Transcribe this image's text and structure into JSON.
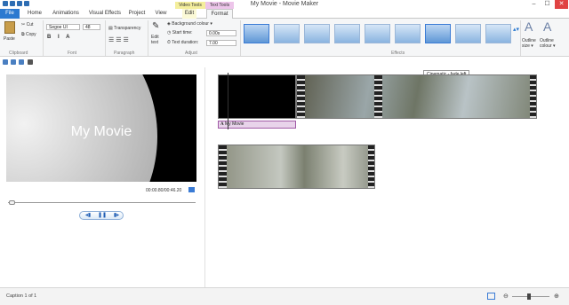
{
  "window": {
    "title": "My Movie - Movie Maker",
    "min": "–",
    "max": "☐",
    "close": "✕"
  },
  "context_tabs": {
    "video_tools": "Video Tools",
    "text_tools": "Text Tools"
  },
  "tabs": [
    "File",
    "Home",
    "Animations",
    "Visual Effects",
    "Project",
    "View",
    "Edit",
    "Format"
  ],
  "ribbon": {
    "paste": "Paste",
    "cut": "Cut",
    "copy": "Copy",
    "font_name": "Segoe UI",
    "font_size": "48",
    "transparency": "Transparency",
    "edit_text": "Edit text",
    "background_colour": "Background colour ▾",
    "start_time_label": "Start time:",
    "start_time": "0.00s",
    "text_duration_label": "Text duration:",
    "text_duration": "7.00",
    "outline_size": "Outline size ▾",
    "outline_colour": "Outline colour ▾",
    "groups": {
      "clipboard": "Clipboard",
      "font": "Font",
      "paragraph": "Paragraph",
      "adjust": "Adjust",
      "effects": "Effects"
    }
  },
  "tooltip": "Cinematic - fade left",
  "preview": {
    "title": "My Movie",
    "timecode": "00:00.80/00:46.20"
  },
  "caption_clip": "My Movie",
  "status": {
    "caption_count": "Caption 1 of 1"
  },
  "colors": {
    "accent": "#2b79d0",
    "caption": "#e8d3ea"
  }
}
